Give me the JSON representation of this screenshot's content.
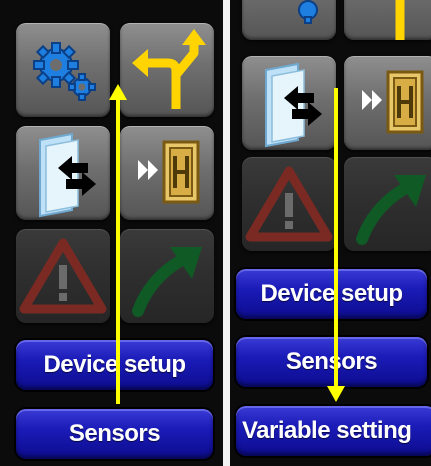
{
  "left_panel": {
    "buttons": {
      "device_setup": "Device setup",
      "sensors": "Sensors"
    }
  },
  "right_panel": {
    "buttons": {
      "device_setup": "Device setup",
      "sensors": "Sensors",
      "variable_settings": "Variable setting"
    }
  },
  "icons": [
    "gears-icon",
    "route-arrows-icon",
    "folder-transfer-icon",
    "exit-door-icon",
    "warning-icon",
    "trend-arrow-icon"
  ],
  "colors": {
    "panel_background": "#0b0b0b",
    "button_blue": "#1b1bb8",
    "annotation_arrow": "#ffff00",
    "icon_yellow": "#ffd400",
    "gear_blue": "#1e7fe0"
  }
}
